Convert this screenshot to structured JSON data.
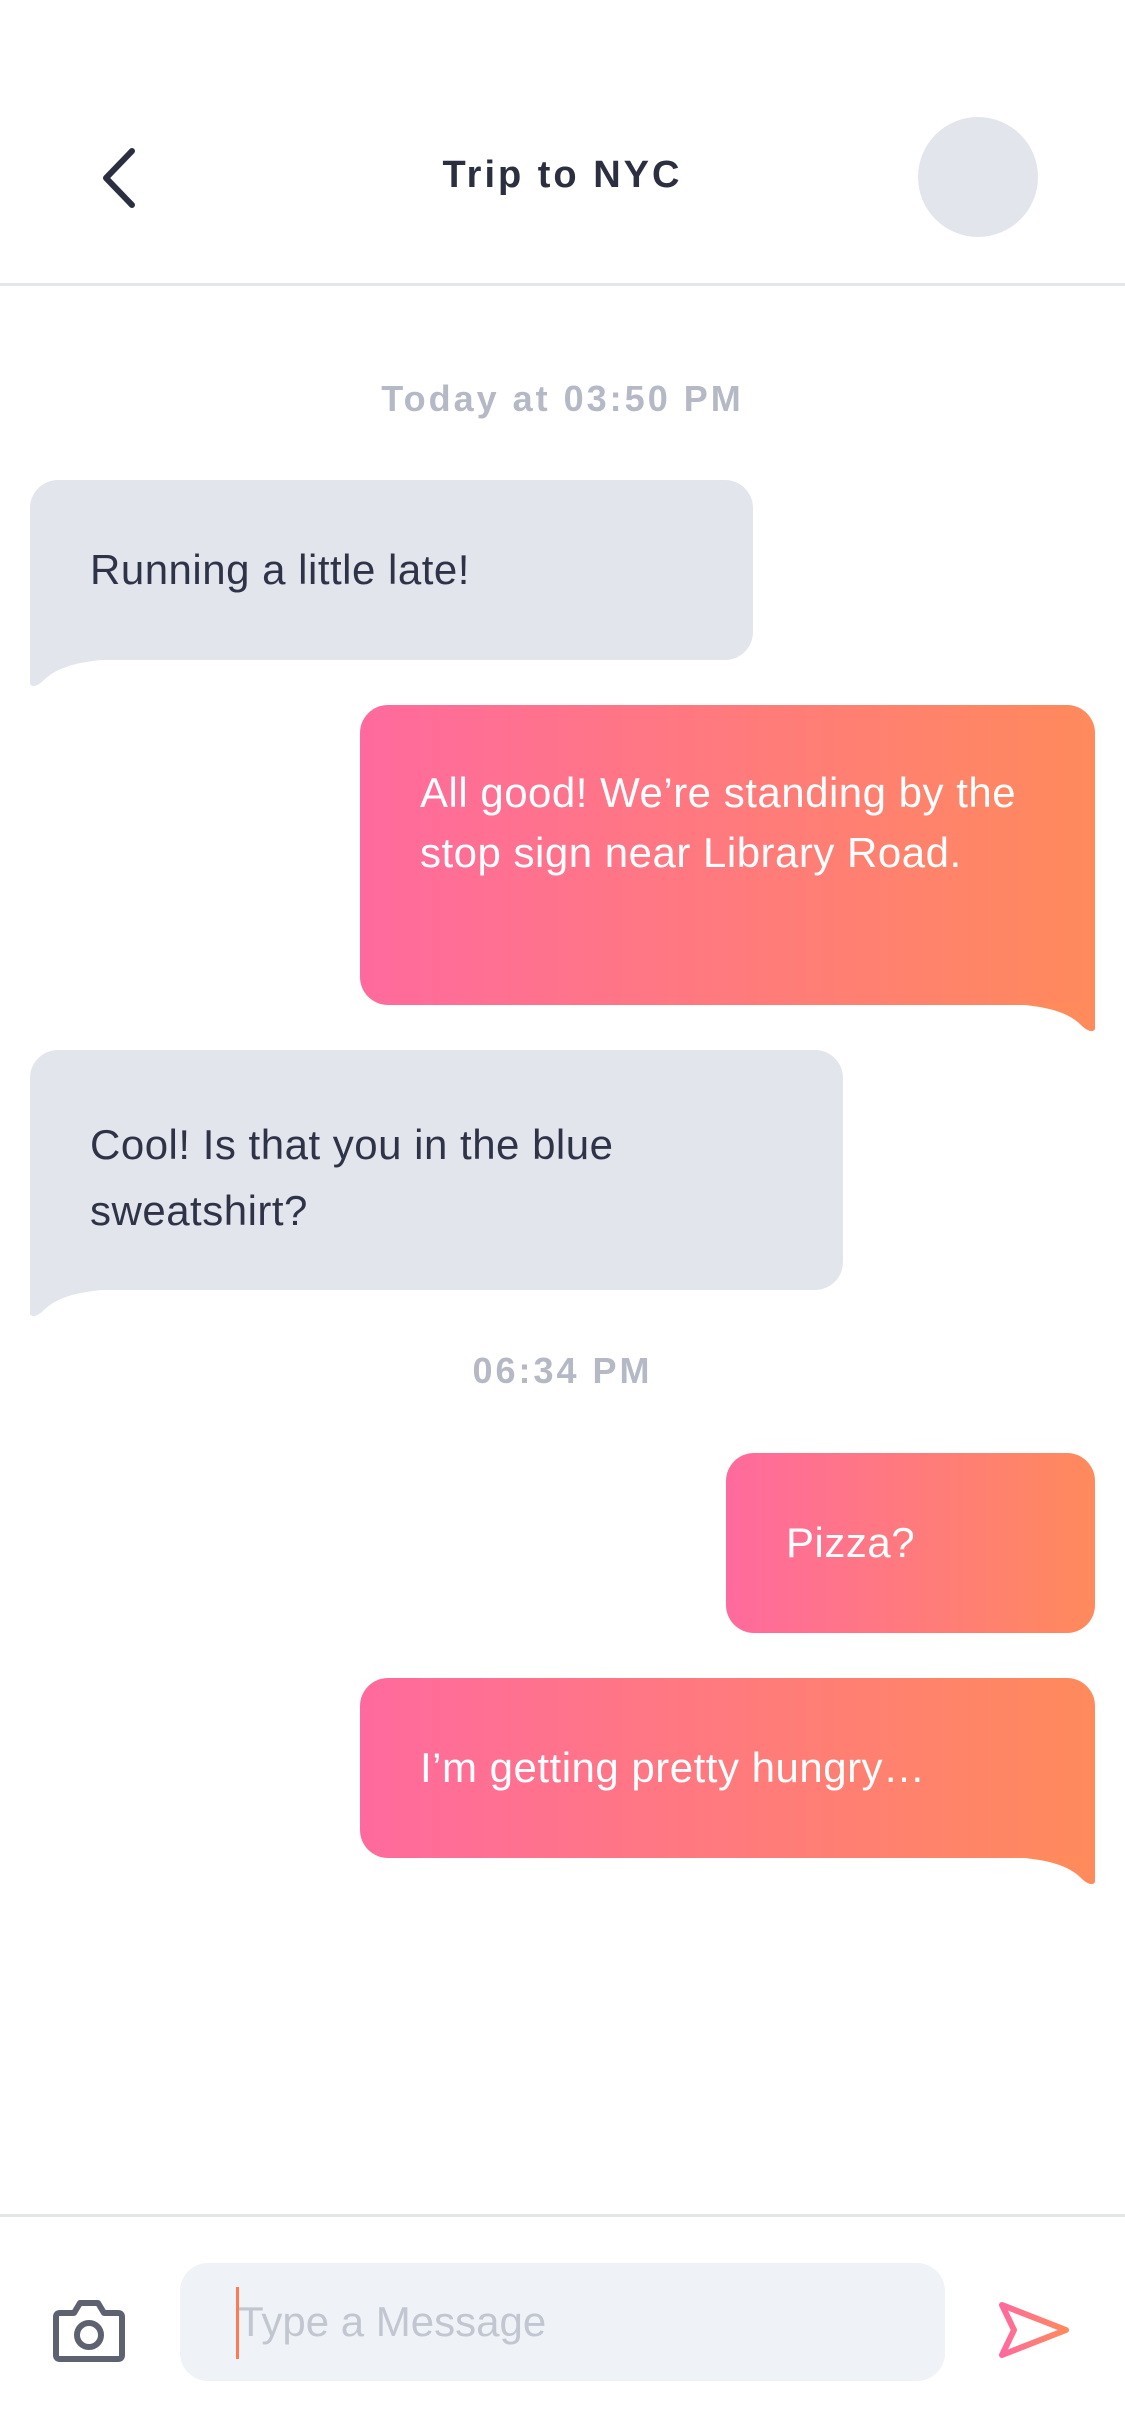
{
  "header": {
    "title": "Trip to NYC"
  },
  "messages": [
    {
      "type": "timestamp",
      "text": "Today at 03:50 PM"
    },
    {
      "type": "received",
      "text": "Running a little late!"
    },
    {
      "type": "sent",
      "text": "All good! We’re standing by the stop sign near Library Road."
    },
    {
      "type": "received",
      "text": "Cool! Is that you in the blue sweatshirt?"
    },
    {
      "type": "timestamp",
      "text": "06:34 PM"
    },
    {
      "type": "sent",
      "text": "Pizza?"
    },
    {
      "type": "sent",
      "text": "I’m getting pretty hungry…"
    }
  ],
  "composer": {
    "placeholder": "Type a Message",
    "value": ""
  },
  "icons": {
    "back": "chevron-left-icon",
    "camera": "camera-icon",
    "send": "send-icon"
  },
  "colors": {
    "received_bubble": "#e3e5ed",
    "sent_gradient_start": "#ff6a9e",
    "sent_gradient_end": "#ff8a5c",
    "title_text": "#2b2f3f",
    "timestamp_text": "#b5b9c6"
  }
}
